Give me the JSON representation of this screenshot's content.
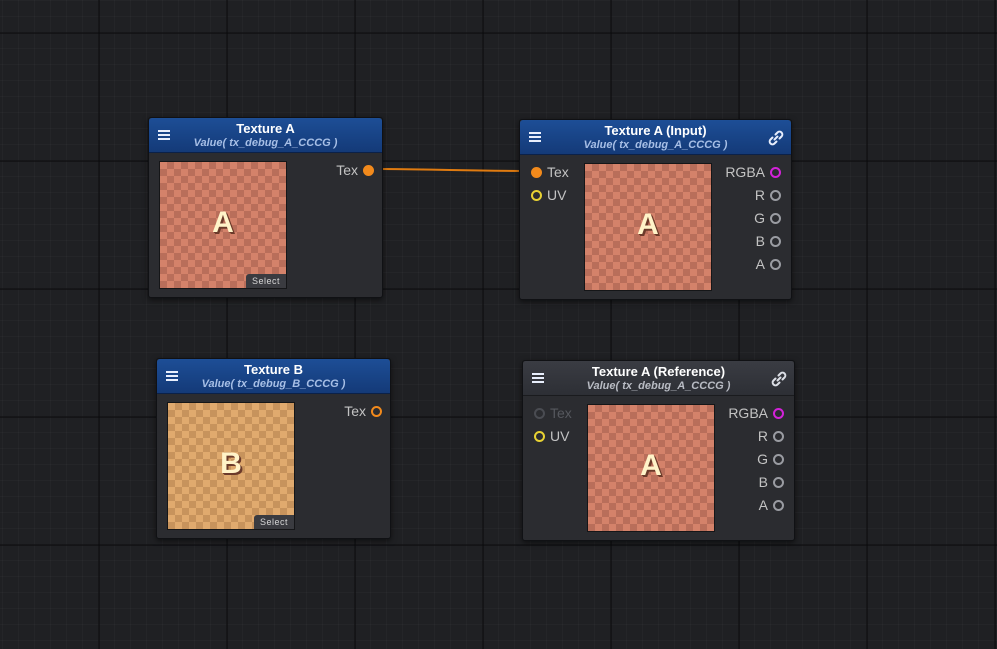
{
  "nodes": {
    "texture_a": {
      "title": "Texture A",
      "subtitle": "Value( tx_debug_A_CCCG )",
      "preview_letter": "A",
      "select_label": "Select",
      "output_label": "Tex"
    },
    "texture_a_input": {
      "title": "Texture A (Input)",
      "subtitle": "Value( tx_debug_A_CCCG )",
      "preview_letter": "A",
      "inputs": [
        "Tex",
        "UV"
      ],
      "outputs": [
        "RGBA",
        "R",
        "G",
        "B",
        "A"
      ]
    },
    "texture_b": {
      "title": "Texture B",
      "subtitle": "Value( tx_debug_B_CCCG )",
      "preview_letter": "B",
      "select_label": "Select",
      "output_label": "Tex"
    },
    "texture_a_reference": {
      "title": "Texture A (Reference)",
      "subtitle": "Value( tx_debug_A_CCCG )",
      "preview_letter": "A",
      "inputs": [
        "Tex",
        "UV"
      ],
      "outputs": [
        "RGBA",
        "R",
        "G",
        "B",
        "A"
      ]
    }
  },
  "icons": {
    "menu": "menu-icon",
    "link": "link-icon"
  },
  "colors": {
    "canvas": "#1f2023",
    "node_header": "#1d4e96",
    "texture_port": "#f28a1c",
    "uv_port": "#e8d233",
    "rgba_port": "#d322d9",
    "channel_port": "#9a9ca2",
    "wire": "#e07b10"
  }
}
